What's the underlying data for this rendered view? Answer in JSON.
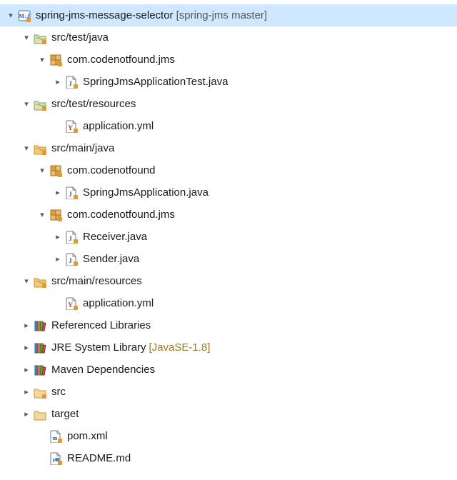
{
  "indent_unit": 22,
  "base_indent": 6,
  "colors": {
    "selection": "#cfe8ff",
    "branch_suffix": "#555555",
    "jre_suffix": "#9a7a2a"
  },
  "rows": [
    {
      "depth": 0,
      "arrow": "down",
      "icon": "maven-project",
      "label": "spring-jms-message-selector",
      "suffix": "[spring-jms master]",
      "suffix_style": "branch",
      "selected": true
    },
    {
      "depth": 1,
      "arrow": "down",
      "icon": "src-test",
      "label": "src/test/java"
    },
    {
      "depth": 2,
      "arrow": "down",
      "icon": "package",
      "label": "com.codenotfound.jms"
    },
    {
      "depth": 3,
      "arrow": "right",
      "icon": "java-file",
      "label": "SpringJmsApplicationTest.java"
    },
    {
      "depth": 1,
      "arrow": "down",
      "icon": "src-test",
      "label": "src/test/resources"
    },
    {
      "depth": 3,
      "arrow": "none",
      "icon": "yaml-file",
      "label": "application.yml"
    },
    {
      "depth": 1,
      "arrow": "down",
      "icon": "src-main",
      "label": "src/main/java"
    },
    {
      "depth": 2,
      "arrow": "down",
      "icon": "package",
      "label": "com.codenotfound"
    },
    {
      "depth": 3,
      "arrow": "right",
      "icon": "java-file",
      "label": "SpringJmsApplication.java"
    },
    {
      "depth": 2,
      "arrow": "down",
      "icon": "package",
      "label": "com.codenotfound.jms"
    },
    {
      "depth": 3,
      "arrow": "right",
      "icon": "java-file",
      "label": "Receiver.java"
    },
    {
      "depth": 3,
      "arrow": "right",
      "icon": "java-file",
      "label": "Sender.java"
    },
    {
      "depth": 1,
      "arrow": "down",
      "icon": "src-main",
      "label": "src/main/resources"
    },
    {
      "depth": 3,
      "arrow": "none",
      "icon": "yaml-file",
      "label": "application.yml"
    },
    {
      "depth": 1,
      "arrow": "right",
      "icon": "library",
      "label": "Referenced Libraries"
    },
    {
      "depth": 1,
      "arrow": "right",
      "icon": "library",
      "label": "JRE System Library",
      "suffix": "[JavaSE-1.8]",
      "suffix_style": "jre"
    },
    {
      "depth": 1,
      "arrow": "right",
      "icon": "library",
      "label": "Maven Dependencies"
    },
    {
      "depth": 1,
      "arrow": "right",
      "icon": "folder-vc",
      "label": "src"
    },
    {
      "depth": 1,
      "arrow": "right",
      "icon": "folder",
      "label": "target"
    },
    {
      "depth": 2,
      "arrow": "none",
      "icon": "xml-file",
      "label": "pom.xml"
    },
    {
      "depth": 2,
      "arrow": "none",
      "icon": "md-file",
      "label": "README.md"
    }
  ]
}
